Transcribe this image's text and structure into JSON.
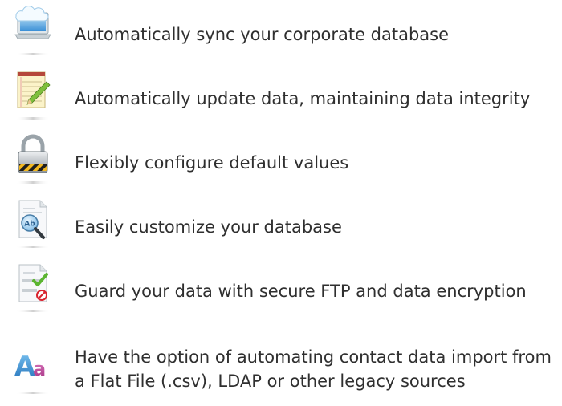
{
  "features": [
    {
      "icon": "cloud-laptop-icon",
      "text": "Automatically sync your corporate database"
    },
    {
      "icon": "notepad-pencil-icon",
      "text": "Automatically update data, maintaining data integrity"
    },
    {
      "icon": "padlock-icon",
      "text": "Flexibly configure default values"
    },
    {
      "icon": "document-magnifier-icon",
      "text": "Easily customize your database"
    },
    {
      "icon": "secure-document-icon",
      "text": "Guard your data with secure FTP and data encryption"
    },
    {
      "icon": "font-aa-icon",
      "text": "Have the option of automating contact data import from a Flat File (.csv), LDAP or other legacy sources"
    }
  ],
  "colors": {
    "text": "#2f2f2f",
    "accent_blue": "#3a8fd6",
    "check_green": "#5cb531",
    "stop_red": "#d9232e",
    "font_pink": "#c2489a"
  }
}
